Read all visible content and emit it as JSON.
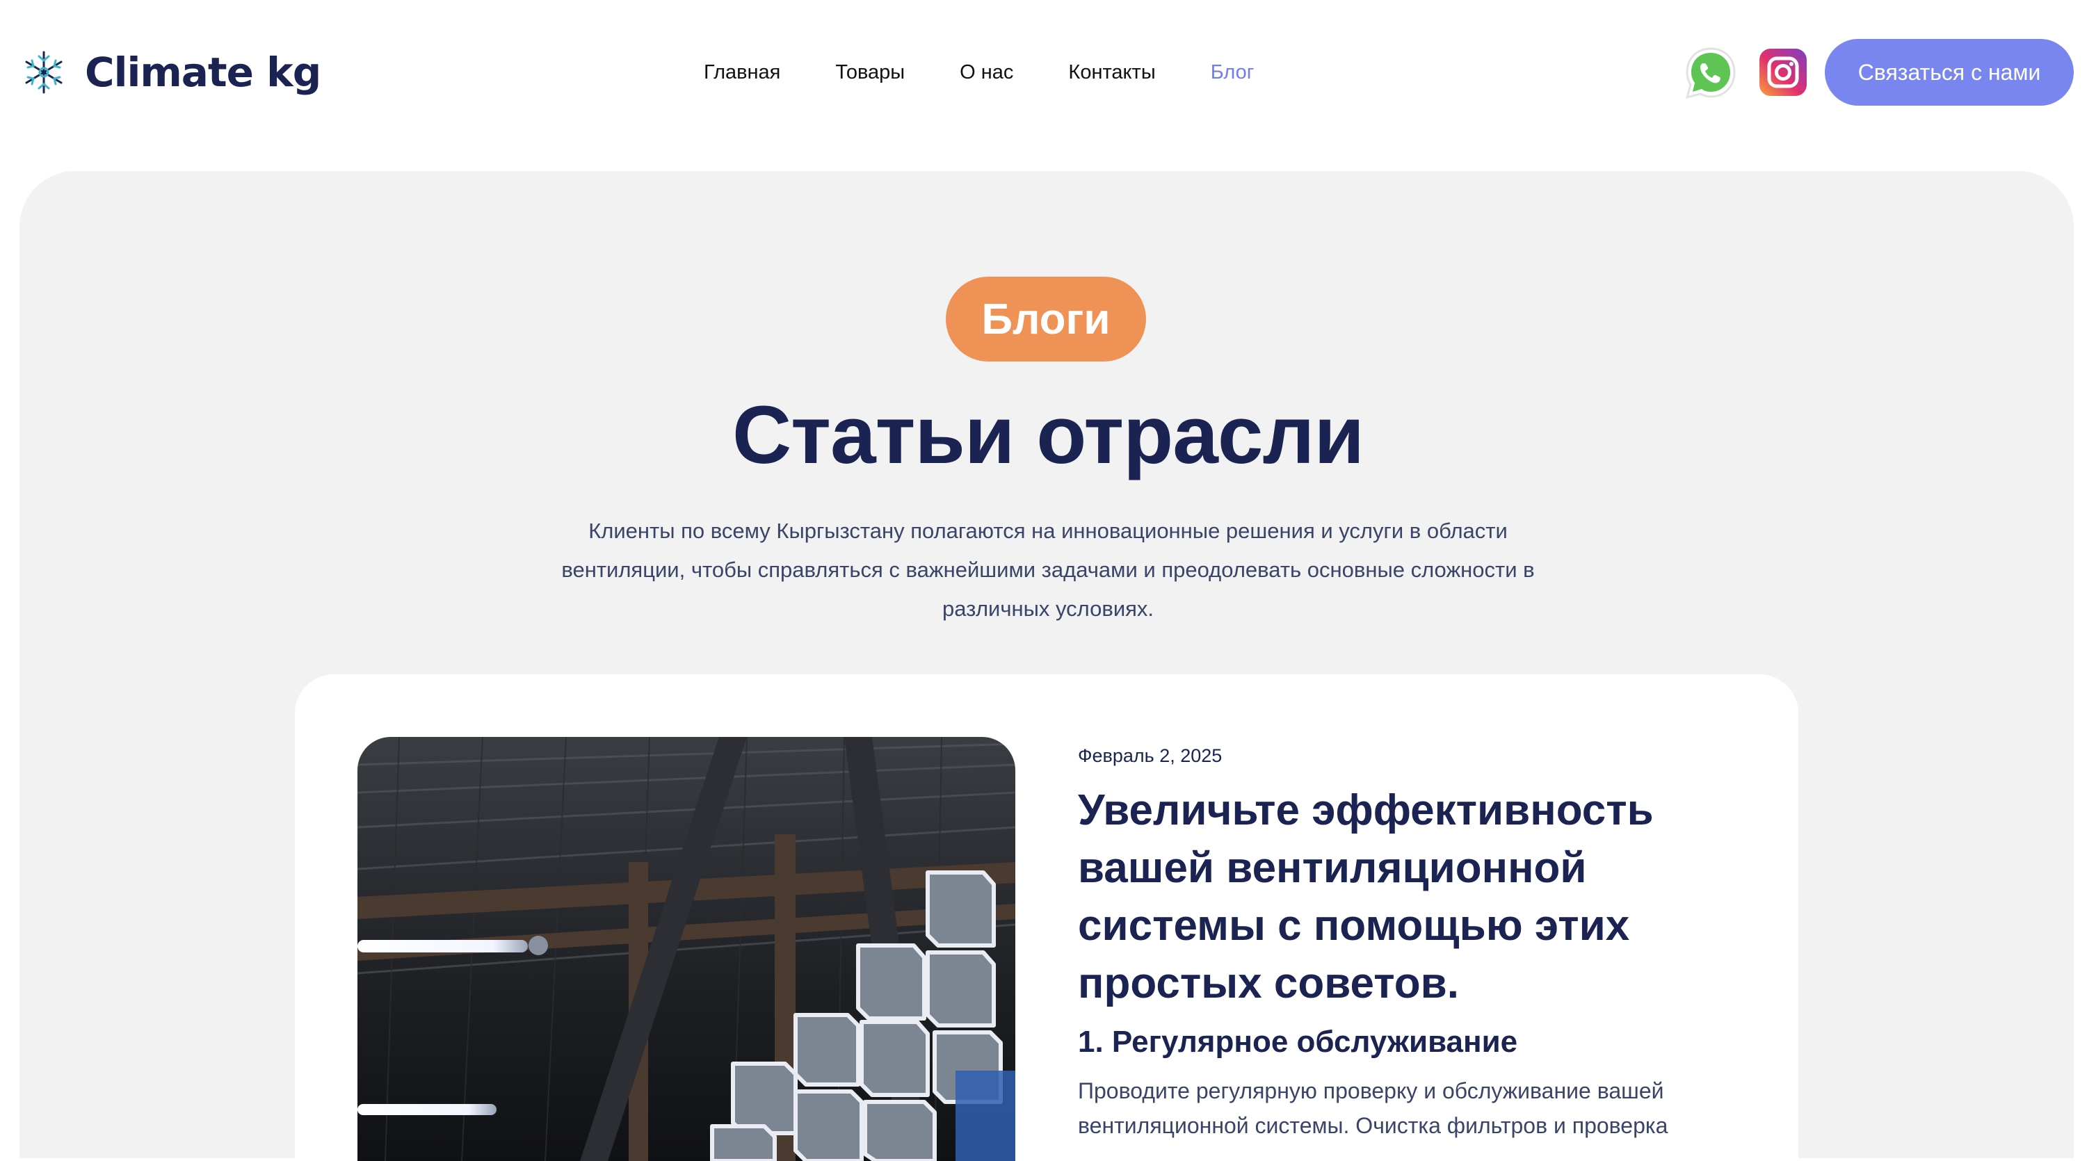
{
  "brand": {
    "name": "Climate kg",
    "logo_icon": "snowflake-fan-icon"
  },
  "nav": {
    "items": [
      {
        "label": "Главная",
        "active": false
      },
      {
        "label": "Товары",
        "active": false
      },
      {
        "label": "О нас",
        "active": false
      },
      {
        "label": "Контакты",
        "active": false
      },
      {
        "label": "Блог",
        "active": true
      }
    ],
    "active_color": "#6f7cf2"
  },
  "social": {
    "whatsapp_icon": "whatsapp-icon",
    "instagram_icon": "instagram-icon"
  },
  "header": {
    "contact_label": "Связаться с нами",
    "contact_color": "#7a86f0"
  },
  "hero": {
    "badge": "Блоги",
    "badge_color": "#ef9256",
    "title": "Статьи отрасли",
    "subtitle": "Клиенты по всему Кыргызстану полагаются на инновационные решения и услуги в области вентиляции, чтобы справляться с важнейшими задачами и преодолевать основные сложности в различных условиях."
  },
  "article": {
    "date": "Февраль 2, 2025",
    "title": "Увеличьте эффективность вашей вентиляционной системы с помощью этих простых советов.",
    "subheading": "1. Регулярное обслуживание",
    "paragraph": "Проводите регулярную проверку и обслуживание вашей вентиляционной системы. Очистка фильтров и проверка"
  },
  "colors": {
    "text_dark": "#1a2351",
    "panel_bg": "#f2f2f2"
  }
}
